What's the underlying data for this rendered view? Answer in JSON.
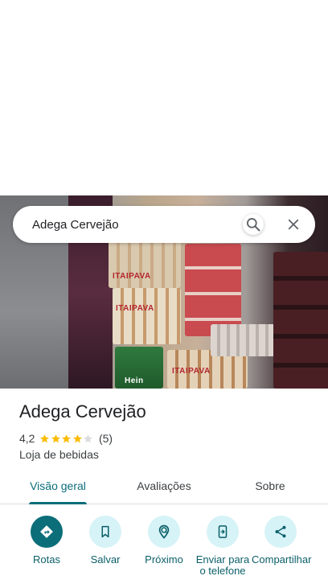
{
  "search": {
    "value": "Adega Cervejão",
    "search_icon": "search-icon",
    "close_icon": "close-icon"
  },
  "photo": {
    "brand_texts": [
      "ITAIPAVA",
      "ITAIPAVA",
      "ITAIPAVA",
      "Hein"
    ]
  },
  "place": {
    "name": "Adega Cervejão",
    "rating": "4,2",
    "rating_value": 4.2,
    "stars_max": 5,
    "review_count": "(5)",
    "category": "Loja de bebidas",
    "star_color": "#fbbc04",
    "star_empty_color": "#dadce0"
  },
  "tabs": [
    {
      "label": "Visão geral",
      "active": true
    },
    {
      "label": "Avaliações",
      "active": false
    },
    {
      "label": "Sobre",
      "active": false
    }
  ],
  "actions": [
    {
      "label": "Rotas",
      "icon": "directions-icon"
    },
    {
      "label": "Salvar",
      "icon": "bookmark-icon"
    },
    {
      "label": "Próximo",
      "icon": "nearby-icon"
    },
    {
      "label": "Enviar para o telefone",
      "icon": "send-to-phone-icon"
    },
    {
      "label": "Compartilhar",
      "icon": "share-icon"
    }
  ],
  "colors": {
    "accent": "#0b6e79",
    "accent_light": "#d6f3f7"
  }
}
